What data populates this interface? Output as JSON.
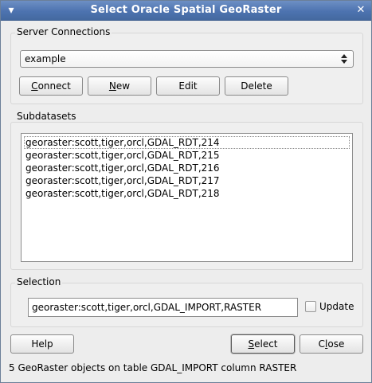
{
  "window": {
    "title": "Select Oracle Spatial GeoRaster",
    "menu_icon": "window-menu-icon",
    "close_icon": "close-icon"
  },
  "server_connections": {
    "label": "Server Connections",
    "selected_connection": "example",
    "dropdown_icon": "updown-arrows-icon",
    "buttons": {
      "connect_label": "Connect",
      "new_label": "New",
      "edit_label": "Edit",
      "delete_label": "Delete"
    }
  },
  "subdatasets": {
    "label": "Subdatasets",
    "items": [
      "georaster:scott,tiger,orcl,GDAL_RDT,214",
      "georaster:scott,tiger,orcl,GDAL_RDT,215",
      "georaster:scott,tiger,orcl,GDAL_RDT,216",
      "georaster:scott,tiger,orcl,GDAL_RDT,217",
      "georaster:scott,tiger,orcl,GDAL_RDT,218"
    ]
  },
  "selection": {
    "label": "Selection",
    "value": "georaster:scott,tiger,orcl,GDAL_IMPORT,RASTER",
    "update_label": "Update",
    "update_checked": false
  },
  "footer": {
    "help_label": "Help",
    "select_label": "Select",
    "close_label": "Close",
    "status_text": "5 GeoRaster objects on table GDAL_IMPORT column RASTER"
  },
  "colors": {
    "titlebar": "#4d73b0",
    "dialog_background": "#ededed",
    "list_background": "#ffffff"
  }
}
